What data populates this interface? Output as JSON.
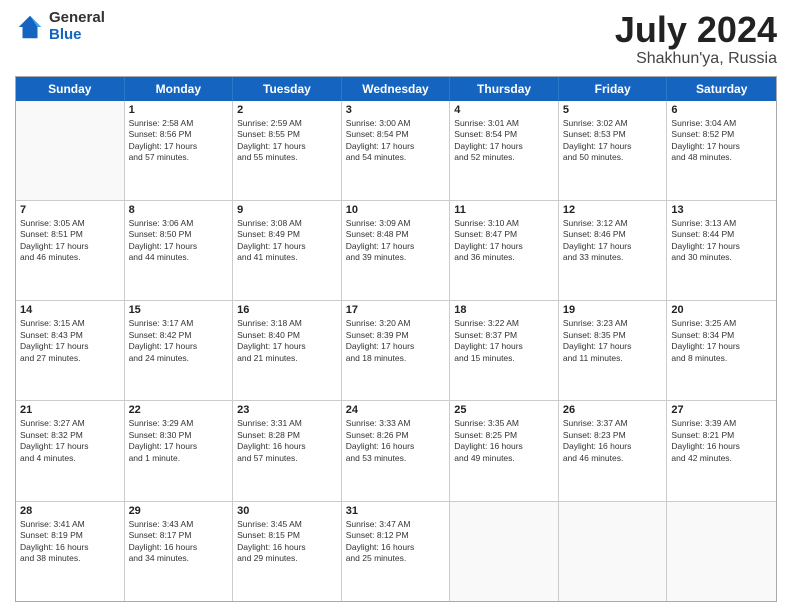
{
  "logo": {
    "general": "General",
    "blue": "Blue"
  },
  "title": {
    "month": "July 2024",
    "location": "Shakhun'ya, Russia"
  },
  "header_days": [
    "Sunday",
    "Monday",
    "Tuesday",
    "Wednesday",
    "Thursday",
    "Friday",
    "Saturday"
  ],
  "weeks": [
    [
      {
        "day": "",
        "empty": true
      },
      {
        "day": "1",
        "lines": [
          "Sunrise: 2:58 AM",
          "Sunset: 8:56 PM",
          "Daylight: 17 hours",
          "and 57 minutes."
        ]
      },
      {
        "day": "2",
        "lines": [
          "Sunrise: 2:59 AM",
          "Sunset: 8:55 PM",
          "Daylight: 17 hours",
          "and 55 minutes."
        ]
      },
      {
        "day": "3",
        "lines": [
          "Sunrise: 3:00 AM",
          "Sunset: 8:54 PM",
          "Daylight: 17 hours",
          "and 54 minutes."
        ]
      },
      {
        "day": "4",
        "lines": [
          "Sunrise: 3:01 AM",
          "Sunset: 8:54 PM",
          "Daylight: 17 hours",
          "and 52 minutes."
        ]
      },
      {
        "day": "5",
        "lines": [
          "Sunrise: 3:02 AM",
          "Sunset: 8:53 PM",
          "Daylight: 17 hours",
          "and 50 minutes."
        ]
      },
      {
        "day": "6",
        "lines": [
          "Sunrise: 3:04 AM",
          "Sunset: 8:52 PM",
          "Daylight: 17 hours",
          "and 48 minutes."
        ]
      }
    ],
    [
      {
        "day": "7",
        "lines": [
          "Sunrise: 3:05 AM",
          "Sunset: 8:51 PM",
          "Daylight: 17 hours",
          "and 46 minutes."
        ]
      },
      {
        "day": "8",
        "lines": [
          "Sunrise: 3:06 AM",
          "Sunset: 8:50 PM",
          "Daylight: 17 hours",
          "and 44 minutes."
        ]
      },
      {
        "day": "9",
        "lines": [
          "Sunrise: 3:08 AM",
          "Sunset: 8:49 PM",
          "Daylight: 17 hours",
          "and 41 minutes."
        ]
      },
      {
        "day": "10",
        "lines": [
          "Sunrise: 3:09 AM",
          "Sunset: 8:48 PM",
          "Daylight: 17 hours",
          "and 39 minutes."
        ]
      },
      {
        "day": "11",
        "lines": [
          "Sunrise: 3:10 AM",
          "Sunset: 8:47 PM",
          "Daylight: 17 hours",
          "and 36 minutes."
        ]
      },
      {
        "day": "12",
        "lines": [
          "Sunrise: 3:12 AM",
          "Sunset: 8:46 PM",
          "Daylight: 17 hours",
          "and 33 minutes."
        ]
      },
      {
        "day": "13",
        "lines": [
          "Sunrise: 3:13 AM",
          "Sunset: 8:44 PM",
          "Daylight: 17 hours",
          "and 30 minutes."
        ]
      }
    ],
    [
      {
        "day": "14",
        "lines": [
          "Sunrise: 3:15 AM",
          "Sunset: 8:43 PM",
          "Daylight: 17 hours",
          "and 27 minutes."
        ]
      },
      {
        "day": "15",
        "lines": [
          "Sunrise: 3:17 AM",
          "Sunset: 8:42 PM",
          "Daylight: 17 hours",
          "and 24 minutes."
        ]
      },
      {
        "day": "16",
        "lines": [
          "Sunrise: 3:18 AM",
          "Sunset: 8:40 PM",
          "Daylight: 17 hours",
          "and 21 minutes."
        ]
      },
      {
        "day": "17",
        "lines": [
          "Sunrise: 3:20 AM",
          "Sunset: 8:39 PM",
          "Daylight: 17 hours",
          "and 18 minutes."
        ]
      },
      {
        "day": "18",
        "lines": [
          "Sunrise: 3:22 AM",
          "Sunset: 8:37 PM",
          "Daylight: 17 hours",
          "and 15 minutes."
        ]
      },
      {
        "day": "19",
        "lines": [
          "Sunrise: 3:23 AM",
          "Sunset: 8:35 PM",
          "Daylight: 17 hours",
          "and 11 minutes."
        ]
      },
      {
        "day": "20",
        "lines": [
          "Sunrise: 3:25 AM",
          "Sunset: 8:34 PM",
          "Daylight: 17 hours",
          "and 8 minutes."
        ]
      }
    ],
    [
      {
        "day": "21",
        "lines": [
          "Sunrise: 3:27 AM",
          "Sunset: 8:32 PM",
          "Daylight: 17 hours",
          "and 4 minutes."
        ]
      },
      {
        "day": "22",
        "lines": [
          "Sunrise: 3:29 AM",
          "Sunset: 8:30 PM",
          "Daylight: 17 hours",
          "and 1 minute."
        ]
      },
      {
        "day": "23",
        "lines": [
          "Sunrise: 3:31 AM",
          "Sunset: 8:28 PM",
          "Daylight: 16 hours",
          "and 57 minutes."
        ]
      },
      {
        "day": "24",
        "lines": [
          "Sunrise: 3:33 AM",
          "Sunset: 8:26 PM",
          "Daylight: 16 hours",
          "and 53 minutes."
        ]
      },
      {
        "day": "25",
        "lines": [
          "Sunrise: 3:35 AM",
          "Sunset: 8:25 PM",
          "Daylight: 16 hours",
          "and 49 minutes."
        ]
      },
      {
        "day": "26",
        "lines": [
          "Sunrise: 3:37 AM",
          "Sunset: 8:23 PM",
          "Daylight: 16 hours",
          "and 46 minutes."
        ]
      },
      {
        "day": "27",
        "lines": [
          "Sunrise: 3:39 AM",
          "Sunset: 8:21 PM",
          "Daylight: 16 hours",
          "and 42 minutes."
        ]
      }
    ],
    [
      {
        "day": "28",
        "lines": [
          "Sunrise: 3:41 AM",
          "Sunset: 8:19 PM",
          "Daylight: 16 hours",
          "and 38 minutes."
        ]
      },
      {
        "day": "29",
        "lines": [
          "Sunrise: 3:43 AM",
          "Sunset: 8:17 PM",
          "Daylight: 16 hours",
          "and 34 minutes."
        ]
      },
      {
        "day": "30",
        "lines": [
          "Sunrise: 3:45 AM",
          "Sunset: 8:15 PM",
          "Daylight: 16 hours",
          "and 29 minutes."
        ]
      },
      {
        "day": "31",
        "lines": [
          "Sunrise: 3:47 AM",
          "Sunset: 8:12 PM",
          "Daylight: 16 hours",
          "and 25 minutes."
        ]
      },
      {
        "day": "",
        "empty": true
      },
      {
        "day": "",
        "empty": true
      },
      {
        "day": "",
        "empty": true
      }
    ]
  ]
}
